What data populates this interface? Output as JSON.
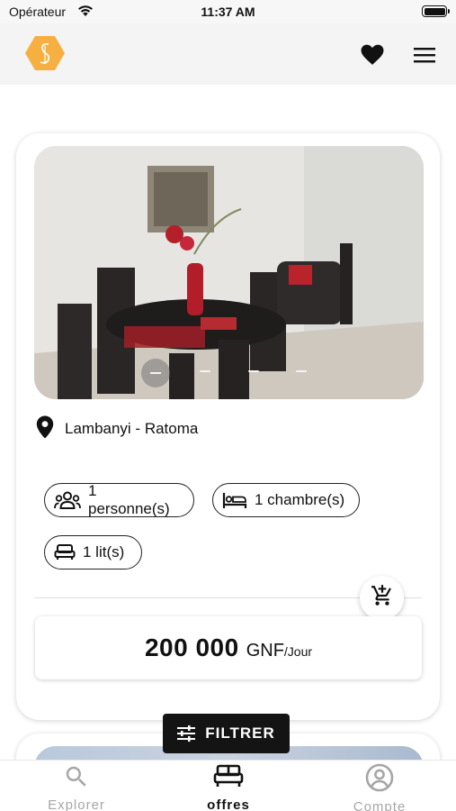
{
  "status_bar": {
    "carrier": "Opérateur",
    "time": "11:37 AM"
  },
  "header": {
    "logo_icon": "hexagon-monogram-logo",
    "brand_color": "#f6b042",
    "favorites_icon": "heart-icon",
    "menu_icon": "hamburger-menu-icon"
  },
  "listing": {
    "photo_count": 4,
    "active_photo_index": 0,
    "location": "Lambanyi - Ratoma",
    "features": {
      "persons": "1 personne(s)",
      "rooms": "1 chambre(s)",
      "beds": "1 lit(s)"
    },
    "price": {
      "amount": "200 000",
      "currency": "GNF",
      "unit": "/Jour"
    }
  },
  "filter_button": {
    "label": "FILTRER"
  },
  "tab_bar": {
    "tabs": [
      {
        "label": "Explorer",
        "icon": "search-icon",
        "active": false
      },
      {
        "label": "offres",
        "icon": "bed-icon",
        "active": true
      },
      {
        "label": "Compte",
        "icon": "account-circle-icon",
        "active": false
      }
    ]
  }
}
